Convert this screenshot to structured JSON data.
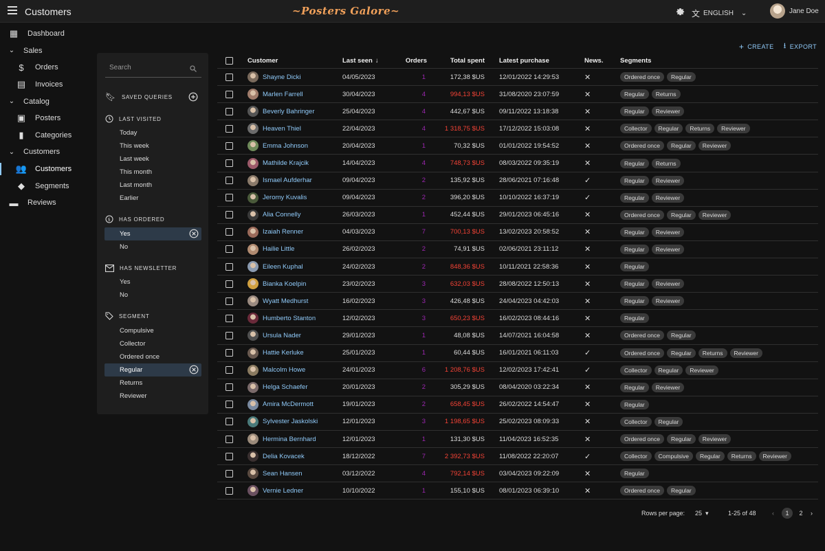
{
  "header": {
    "title": "Customers",
    "brand": "~Posters Galore~",
    "language": "ENGLISH",
    "user": "Jane Doe"
  },
  "sidebar": {
    "items": [
      {
        "label": "Dashboard",
        "kind": "top",
        "icon": "dashboard-icon",
        "glyph": "▦"
      },
      {
        "label": "Sales",
        "kind": "grp",
        "icon": "chevron-down-icon",
        "glyph": "⌄"
      },
      {
        "label": "Orders",
        "kind": "sub",
        "icon": "dollar-icon",
        "glyph": "$"
      },
      {
        "label": "Invoices",
        "kind": "sub",
        "icon": "invoice-icon",
        "glyph": "▤"
      },
      {
        "label": "Catalog",
        "kind": "grp",
        "icon": "chevron-down-icon",
        "glyph": "⌄"
      },
      {
        "label": "Posters",
        "kind": "sub",
        "icon": "image-icon",
        "glyph": "▣"
      },
      {
        "label": "Categories",
        "kind": "sub",
        "icon": "bookmark-icon",
        "glyph": "▮"
      },
      {
        "label": "Customers",
        "kind": "grp",
        "icon": "chevron-down-icon",
        "glyph": "⌄"
      },
      {
        "label": "Customers",
        "kind": "sub",
        "icon": "people-icon",
        "glyph": "👥",
        "active": true
      },
      {
        "label": "Segments",
        "kind": "sub",
        "icon": "label-icon",
        "glyph": "◆"
      },
      {
        "label": "Reviews",
        "kind": "top",
        "icon": "comment-icon",
        "glyph": "▬"
      }
    ]
  },
  "filters": {
    "search_placeholder": "Search",
    "saved_queries": "SAVED QUERIES",
    "last_visited": {
      "title": "LAST VISITED",
      "items": [
        "Today",
        "This week",
        "Last week",
        "This month",
        "Last month",
        "Earlier"
      ]
    },
    "has_ordered": {
      "title": "HAS ORDERED",
      "items": [
        "Yes",
        "No"
      ],
      "selected": "Yes"
    },
    "has_newsletter": {
      "title": "HAS NEWSLETTER",
      "items": [
        "Yes",
        "No"
      ]
    },
    "segment": {
      "title": "SEGMENT",
      "items": [
        "Compulsive",
        "Collector",
        "Ordered once",
        "Regular",
        "Returns",
        "Reviewer"
      ],
      "selected": "Regular"
    }
  },
  "actions": {
    "create": "CREATE",
    "export": "EXPORT"
  },
  "table": {
    "headers": {
      "customer": "Customer",
      "last_seen": "Last seen",
      "orders": "Orders",
      "total_spent": "Total spent",
      "latest_purchase": "Latest purchase",
      "news": "News.",
      "segments": "Segments"
    },
    "rows": [
      {
        "name": "Shayne Dicki",
        "seen": "04/05/2023",
        "orders": "1",
        "spent": "172,38 $US",
        "purchase": "12/01/2022 14:29:53",
        "news": false,
        "segments": [
          "Ordered once",
          "Regular"
        ],
        "high": false,
        "av": "#7a6a5c"
      },
      {
        "name": "Marlen Farrell",
        "seen": "30/04/2023",
        "orders": "4",
        "spent": "994,13 $US",
        "purchase": "31/08/2020 23:07:59",
        "news": false,
        "segments": [
          "Regular",
          "Returns"
        ],
        "high": true,
        "av": "#a07c6b"
      },
      {
        "name": "Beverly Bahringer",
        "seen": "25/04/2023",
        "orders": "4",
        "spent": "442,67 $US",
        "purchase": "09/11/2022 13:18:38",
        "news": false,
        "segments": [
          "Regular",
          "Reviewer"
        ],
        "high": false,
        "av": "#555555"
      },
      {
        "name": "Heaven Thiel",
        "seen": "22/04/2023",
        "orders": "4",
        "spent": "1 318,75 $US",
        "purchase": "17/12/2022 15:03:08",
        "news": false,
        "segments": [
          "Collector",
          "Regular",
          "Returns",
          "Reviewer"
        ],
        "high": true,
        "av": "#6b6b6b"
      },
      {
        "name": "Emma Johnson",
        "seen": "20/04/2023",
        "orders": "1",
        "spent": "70,32 $US",
        "purchase": "01/01/2022 19:54:52",
        "news": false,
        "segments": [
          "Ordered once",
          "Regular",
          "Reviewer"
        ],
        "high": false,
        "av": "#6f8a5a"
      },
      {
        "name": "Mathilde Krajcik",
        "seen": "14/04/2023",
        "orders": "4",
        "spent": "748,73 $US",
        "purchase": "08/03/2022 09:35:19",
        "news": false,
        "segments": [
          "Regular",
          "Returns"
        ],
        "high": true,
        "av": "#9c5a6a"
      },
      {
        "name": "Ismael Aufderhar",
        "seen": "09/04/2023",
        "orders": "2",
        "spent": "135,92 $US",
        "purchase": "28/06/2021 07:16:48",
        "news": true,
        "segments": [
          "Regular",
          "Reviewer"
        ],
        "high": false,
        "av": "#8a7a6a"
      },
      {
        "name": "Jeromy Kuvalis",
        "seen": "09/04/2023",
        "orders": "2",
        "spent": "396,20 $US",
        "purchase": "10/10/2022 16:37:19",
        "news": true,
        "segments": [
          "Regular",
          "Reviewer"
        ],
        "high": false,
        "av": "#4a5a3a"
      },
      {
        "name": "Alia Connelly",
        "seen": "26/03/2023",
        "orders": "1",
        "spent": "452,44 $US",
        "purchase": "29/01/2023 06:45:16",
        "news": false,
        "segments": [
          "Ordered once",
          "Regular",
          "Reviewer"
        ],
        "high": false,
        "av": "#3a3a3a"
      },
      {
        "name": "Izaiah Renner",
        "seen": "04/03/2023",
        "orders": "7",
        "spent": "700,13 $US",
        "purchase": "13/02/2023 20:58:52",
        "news": false,
        "segments": [
          "Regular",
          "Reviewer"
        ],
        "high": true,
        "av": "#9a6a5a"
      },
      {
        "name": "Hailie Little",
        "seen": "26/02/2023",
        "orders": "2",
        "spent": "74,91 $US",
        "purchase": "02/06/2021 23:11:12",
        "news": false,
        "segments": [
          "Regular",
          "Reviewer"
        ],
        "high": false,
        "av": "#b08a70"
      },
      {
        "name": "Eileen Kuphal",
        "seen": "24/02/2023",
        "orders": "2",
        "spent": "848,36 $US",
        "purchase": "10/11/2021 22:58:36",
        "news": false,
        "segments": [
          "Regular"
        ],
        "high": true,
        "av": "#8a9ab0"
      },
      {
        "name": "Bianka Koelpin",
        "seen": "23/02/2023",
        "orders": "3",
        "spent": "632,03 $US",
        "purchase": "28/08/2022 12:50:13",
        "news": false,
        "segments": [
          "Regular",
          "Reviewer"
        ],
        "high": true,
        "av": "#d0a040"
      },
      {
        "name": "Wyatt Medhurst",
        "seen": "16/02/2023",
        "orders": "3",
        "spent": "426,48 $US",
        "purchase": "24/04/2023 04:42:03",
        "news": false,
        "segments": [
          "Regular",
          "Reviewer"
        ],
        "high": false,
        "av": "#9a8a80"
      },
      {
        "name": "Humberto Stanton",
        "seen": "12/02/2023",
        "orders": "3",
        "spent": "650,23 $US",
        "purchase": "16/02/2023 08:44:16",
        "news": false,
        "segments": [
          "Regular"
        ],
        "high": true,
        "av": "#6a2a3a"
      },
      {
        "name": "Ursula Nader",
        "seen": "29/01/2023",
        "orders": "1",
        "spent": "48,08 $US",
        "purchase": "14/07/2021 16:04:58",
        "news": false,
        "segments": [
          "Ordered once",
          "Regular"
        ],
        "high": false,
        "av": "#505050"
      },
      {
        "name": "Hattie Kerluke",
        "seen": "25/01/2023",
        "orders": "1",
        "spent": "60,44 $US",
        "purchase": "16/01/2021 06:11:03",
        "news": true,
        "segments": [
          "Ordered once",
          "Regular",
          "Returns",
          "Reviewer"
        ],
        "high": false,
        "av": "#6a5a50"
      },
      {
        "name": "Malcolm Howe",
        "seen": "24/01/2023",
        "orders": "6",
        "spent": "1 208,76 $US",
        "purchase": "12/02/2023 17:42:41",
        "news": true,
        "segments": [
          "Collector",
          "Regular",
          "Reviewer"
        ],
        "high": true,
        "av": "#8a7a60"
      },
      {
        "name": "Helga Schaefer",
        "seen": "20/01/2023",
        "orders": "2",
        "spent": "305,29 $US",
        "purchase": "08/04/2020 03:22:34",
        "news": false,
        "segments": [
          "Regular",
          "Reviewer"
        ],
        "high": false,
        "av": "#7a6a6a"
      },
      {
        "name": "Amira McDermott",
        "seen": "19/01/2023",
        "orders": "2",
        "spent": "658,45 $US",
        "purchase": "26/02/2022 14:54:47",
        "news": false,
        "segments": [
          "Regular"
        ],
        "high": true,
        "av": "#7a8aa0"
      },
      {
        "name": "Sylvester Jaskolski",
        "seen": "12/01/2023",
        "orders": "3",
        "spent": "1 198,65 $US",
        "purchase": "25/02/2023 08:09:33",
        "news": false,
        "segments": [
          "Collector",
          "Regular"
        ],
        "high": true,
        "av": "#4a7a7a"
      },
      {
        "name": "Hermina Bernhard",
        "seen": "12/01/2023",
        "orders": "1",
        "spent": "131,30 $US",
        "purchase": "11/04/2023 16:52:35",
        "news": false,
        "segments": [
          "Ordered once",
          "Regular",
          "Reviewer"
        ],
        "high": false,
        "av": "#9a8a7a"
      },
      {
        "name": "Delia Kovacek",
        "seen": "18/12/2022",
        "orders": "7",
        "spent": "2 392,73 $US",
        "purchase": "11/08/2022 22:20:07",
        "news": true,
        "segments": [
          "Collector",
          "Compulsive",
          "Regular",
          "Returns",
          "Reviewer"
        ],
        "high": true,
        "av": "#3a3030"
      },
      {
        "name": "Sean Hansen",
        "seen": "03/12/2022",
        "orders": "4",
        "spent": "792,14 $US",
        "purchase": "03/04/2023 09:22:09",
        "news": false,
        "segments": [
          "Regular"
        ],
        "high": true,
        "av": "#5a4a40"
      },
      {
        "name": "Vernie Ledner",
        "seen": "10/10/2022",
        "orders": "1",
        "spent": "155,10 $US",
        "purchase": "08/01/2023 06:39:10",
        "news": false,
        "segments": [
          "Ordered once",
          "Regular"
        ],
        "high": false,
        "av": "#6a5060"
      }
    ]
  },
  "pagination": {
    "rows_label": "Rows per page:",
    "rows_value": "25",
    "range": "1-25 of 48",
    "pages": [
      "1",
      "2"
    ],
    "current": "1"
  },
  "colors": {
    "link": "#90caf9",
    "orders": "#9c27b0",
    "high_spent": "#f44336",
    "brand": "#f0a05a"
  }
}
